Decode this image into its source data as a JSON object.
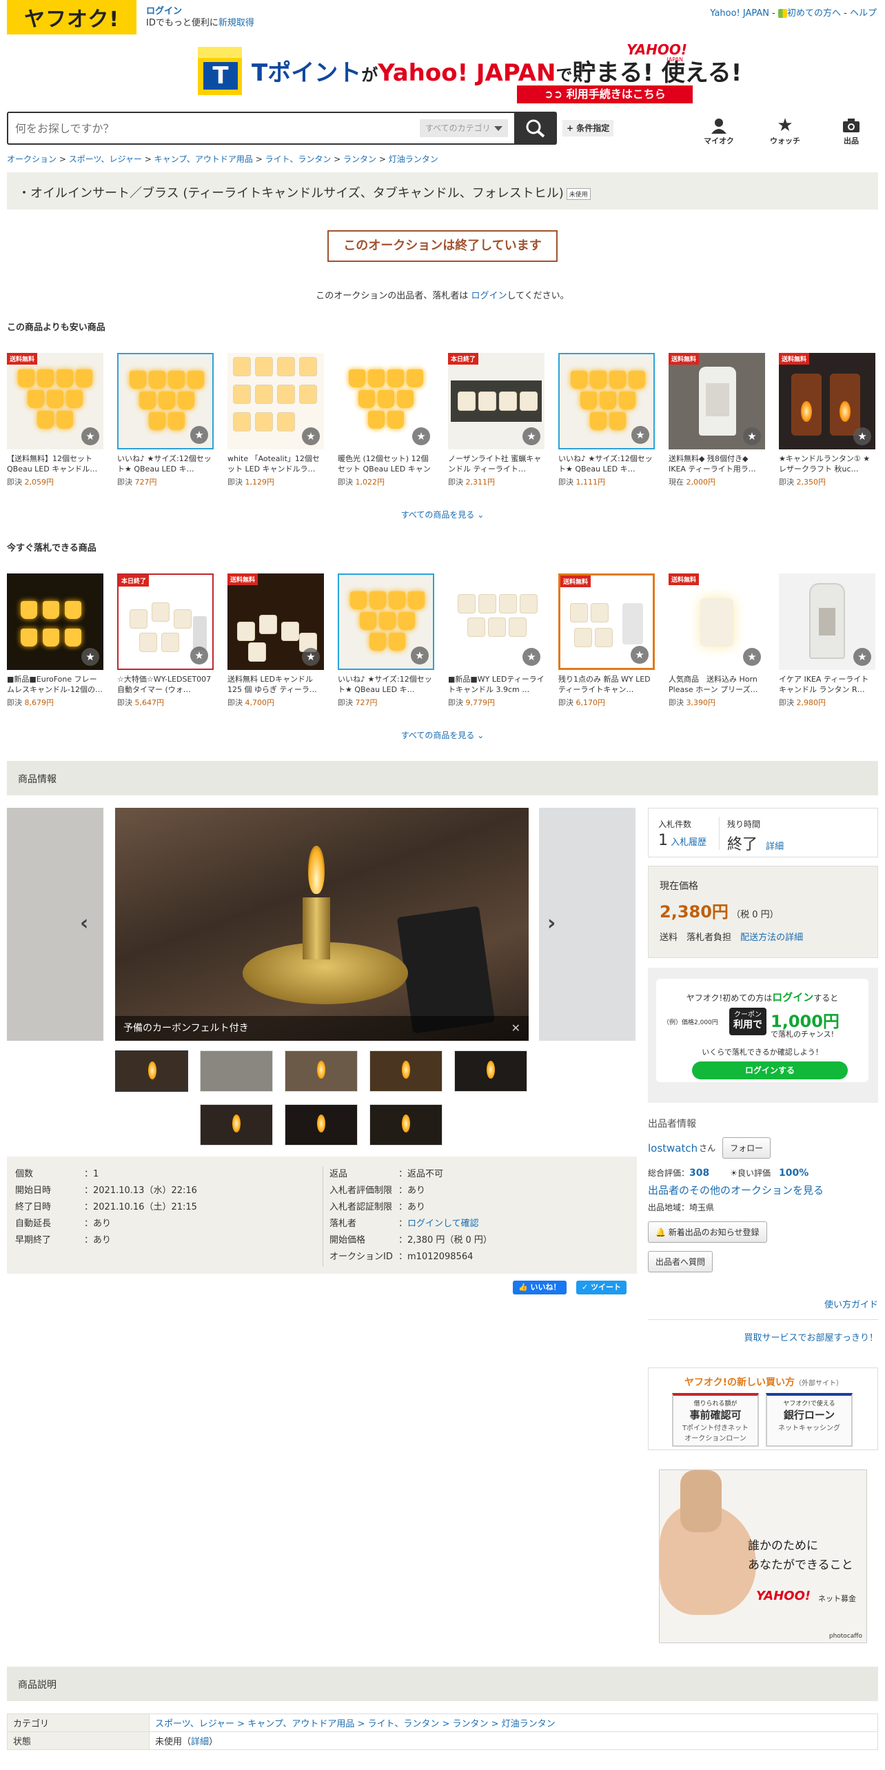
{
  "header": {
    "logo": "ヤフオク!",
    "login": "ログイン",
    "login_sub_prefix": "IDでもっと便利に",
    "register": "新規取得",
    "links": [
      "Yahoo! JAPAN",
      "初めての方へ",
      "ヘルプ"
    ],
    "sep": " - "
  },
  "banner": {
    "t": "T",
    "text_a": "Tポイント",
    "text_b": "が",
    "text_c": "Yahoo! JAPAN",
    "text_d": "で",
    "text_e": "貯まる! 使える!",
    "yahoo": "YAHOO!",
    "japan": "JAPAN",
    "procedure": "利用手続きはこちら"
  },
  "search": {
    "placeholder": "何をお探しですか？",
    "category": "すべてのカテゴリ",
    "conditions": "+ 条件指定"
  },
  "top_icons": [
    {
      "label": "マイオク"
    },
    {
      "label": "ウォッチ"
    },
    {
      "label": "出品"
    }
  ],
  "breadcrumb": [
    "オークション",
    "スポーツ、レジャー",
    "キャンプ、アウトドア用品",
    "ライト、ランタン",
    "ランタン",
    "灯油ランタン"
  ],
  "item": {
    "title": "・オイルインサート／ブラス (ティーライトキャンドルサイズ、タブキャンドル、フォレストヒル)",
    "condition_badge": "未使用",
    "ended": "このオークションは終了しています",
    "login_msg_a": "このオークションの出品者、落札者は ",
    "login_msg_link": "ログイン",
    "login_msg_b": "してください。"
  },
  "cheaper": {
    "heading": "この商品よりも安い商品",
    "see_all": "すべての商品を見る",
    "items": [
      {
        "tag": "送料無料",
        "title": "【送料無料】12個セット QBeau LED キャンドル…",
        "kind": "即決",
        "price": "2,059円"
      },
      {
        "tag": "",
        "title": "いいね♪ ★サイズ:12個セット★ QBeau LED キ…",
        "kind": "即決",
        "price": "727円"
      },
      {
        "tag": "",
        "title": "white 「Aotealit」12個セット LED キャンドルラ…",
        "kind": "即決",
        "price": "1,129円"
      },
      {
        "tag": "",
        "title": "暖色光 (12個セット) 12個セット QBeau LED キャンド…",
        "kind": "即決",
        "price": "1,022円"
      },
      {
        "tag": "本日終了",
        "title": "ノーザンライト社 蜜蝋キャンドル ティーライト…",
        "kind": "即決",
        "price": "2,311円"
      },
      {
        "tag": "",
        "title": "いいね♪ ★サイズ:12個セット★ QBeau LED キ…",
        "kind": "即決",
        "price": "1,111円"
      },
      {
        "tag": "送料無料",
        "title": "送料無料◆ 残8個付き◆ IKEA ティーライト用ラ…",
        "kind": "現在",
        "price": "2,000円"
      },
      {
        "tag": "送料無料",
        "title": "★キャンドルランタン① ★レザークラフト 秋uc…",
        "kind": "即決",
        "price": "2,350円"
      }
    ]
  },
  "buynow": {
    "heading": "今すぐ落札できる商品",
    "see_all": "すべての商品を見る",
    "items": [
      {
        "tag": "",
        "title": "■新品■EuroFone フレームレスキャンドル-12個の…",
        "kind": "即決",
        "price": "8,679円"
      },
      {
        "tag": "本日終了",
        "title": "☆大特価☆WY-LEDSET007 自動タイマー (ウォ…",
        "kind": "即決",
        "price": "5,647円"
      },
      {
        "tag": "送料無料",
        "title": "送料無料 LEDキャンドル 125 個 ゆらぎ ティーラ…",
        "kind": "即決",
        "price": "4,700円"
      },
      {
        "tag": "",
        "title": "いいね♪ ★サイズ:12個セット★ QBeau LED キ…",
        "kind": "即決",
        "price": "727円"
      },
      {
        "tag": "",
        "title": "■新品■WY LEDティーライトキャンドル 3.9cm …",
        "kind": "即決",
        "price": "9,779円"
      },
      {
        "tag": "送料無料",
        "title": "残り1点のみ 新品 WY LEDティーライトキャン…",
        "kind": "即決",
        "price": "6,170円"
      },
      {
        "tag": "送料無料",
        "title": "人気商品　送料込み Horn Please ホーン プリーズ…",
        "kind": "即決",
        "price": "3,390円"
      },
      {
        "tag": "",
        "title": "イケア IKEA ティーライト キャンドル ランタン R…",
        "kind": "即決",
        "price": "2,980円"
      }
    ]
  },
  "info_heading": "商品情報",
  "gallery": {
    "caption": "予備のカーボンフェルト付き"
  },
  "specs_left": [
    {
      "k": "個数",
      "v": "1",
      "link": false
    },
    {
      "k": "開始日時",
      "v": "2021.10.13（水）22:16",
      "link": false
    },
    {
      "k": "終了日時",
      "v": "2021.10.16（土）21:15",
      "link": false
    },
    {
      "k": "自動延長",
      "v": "あり",
      "link": true
    },
    {
      "k": "早期終了",
      "v": "あり",
      "link": true
    }
  ],
  "specs_right": [
    {
      "k": "返品",
      "v": "返品不可",
      "link": false
    },
    {
      "k": "入札者評価制限",
      "v": "あり",
      "link": true
    },
    {
      "k": "入札者認証制限",
      "v": "あり",
      "link": true
    },
    {
      "k": "落札者",
      "v": "ログインして確認",
      "link": false,
      "vlink": true
    },
    {
      "k": "開始価格",
      "v": "2,380 円（税 0 円）",
      "link": false
    },
    {
      "k": "オークションID",
      "v": "m1012098564",
      "link": false
    }
  ],
  "share": {
    "like": "いいね！",
    "tweet": "ツイート"
  },
  "bid": {
    "count_label": "入札件数",
    "count": "1",
    "history": "入札履歴",
    "remaining_label": "残り時間",
    "remaining": "終了",
    "details": "詳細"
  },
  "price": {
    "label": "現在価格",
    "value": "2,380円",
    "tax": "（税 0 円）",
    "shipping_label": "送料",
    "shipping": "落札者負担",
    "shipping_link": "配送方法の詳細"
  },
  "promo": {
    "line1_a": "ヤフオク!初めての方は",
    "line1_b": "ログイン",
    "line1_c": "すると",
    "example": "（例）価格2,000円",
    "coupon": "クーポン",
    "use": "利用で",
    "amount": "1,000円",
    "tail": "で落札のチャンス!",
    "check": "いくらで落札できるか確認しよう！",
    "button": "ログインする"
  },
  "seller": {
    "heading": "出品者情報",
    "name": "lostwatch",
    "san": "さん",
    "follow": "フォロー",
    "rating_label": "総合評価：",
    "rating": "308",
    "good_label": "良い評価",
    "good": "100%",
    "other": "出品者のその他のオークションを見る",
    "region": "出品地域：埼玉県",
    "notify": "新着出品のお知らせ登録",
    "question": "出品者へ質問"
  },
  "sidelinks": {
    "guide": "使い方ガイド",
    "room": "買取サービスでお部屋すっきり！"
  },
  "newbuy": {
    "title": "ヤフオク!の新しい買い方",
    "external": "（外部サイト）",
    "a_top": "借りられる額が",
    "a_main": "事前確認可",
    "a_sub1": "Tポイント付きネット",
    "a_sub2": "オークションローン",
    "b_top": "ヤフオク!で使える",
    "b_main": "銀行ローン",
    "b_sub": "ネットキャッシング"
  },
  "ad": {
    "line1": "誰かのために",
    "line2": "あなたができること",
    "brand": "YAHOO!",
    "sub": "ネット募金",
    "credit": "photocaffo"
  },
  "description": {
    "heading": "商品説明",
    "rows": [
      {
        "k": "カテゴリ",
        "v": "スポーツ、レジャー > キャンプ、アウトドア用品 > ライト、ランタン > ランタン > 灯油ランタン"
      },
      {
        "k": "状態",
        "v": "未使用",
        "detail": "詳細"
      }
    ]
  }
}
